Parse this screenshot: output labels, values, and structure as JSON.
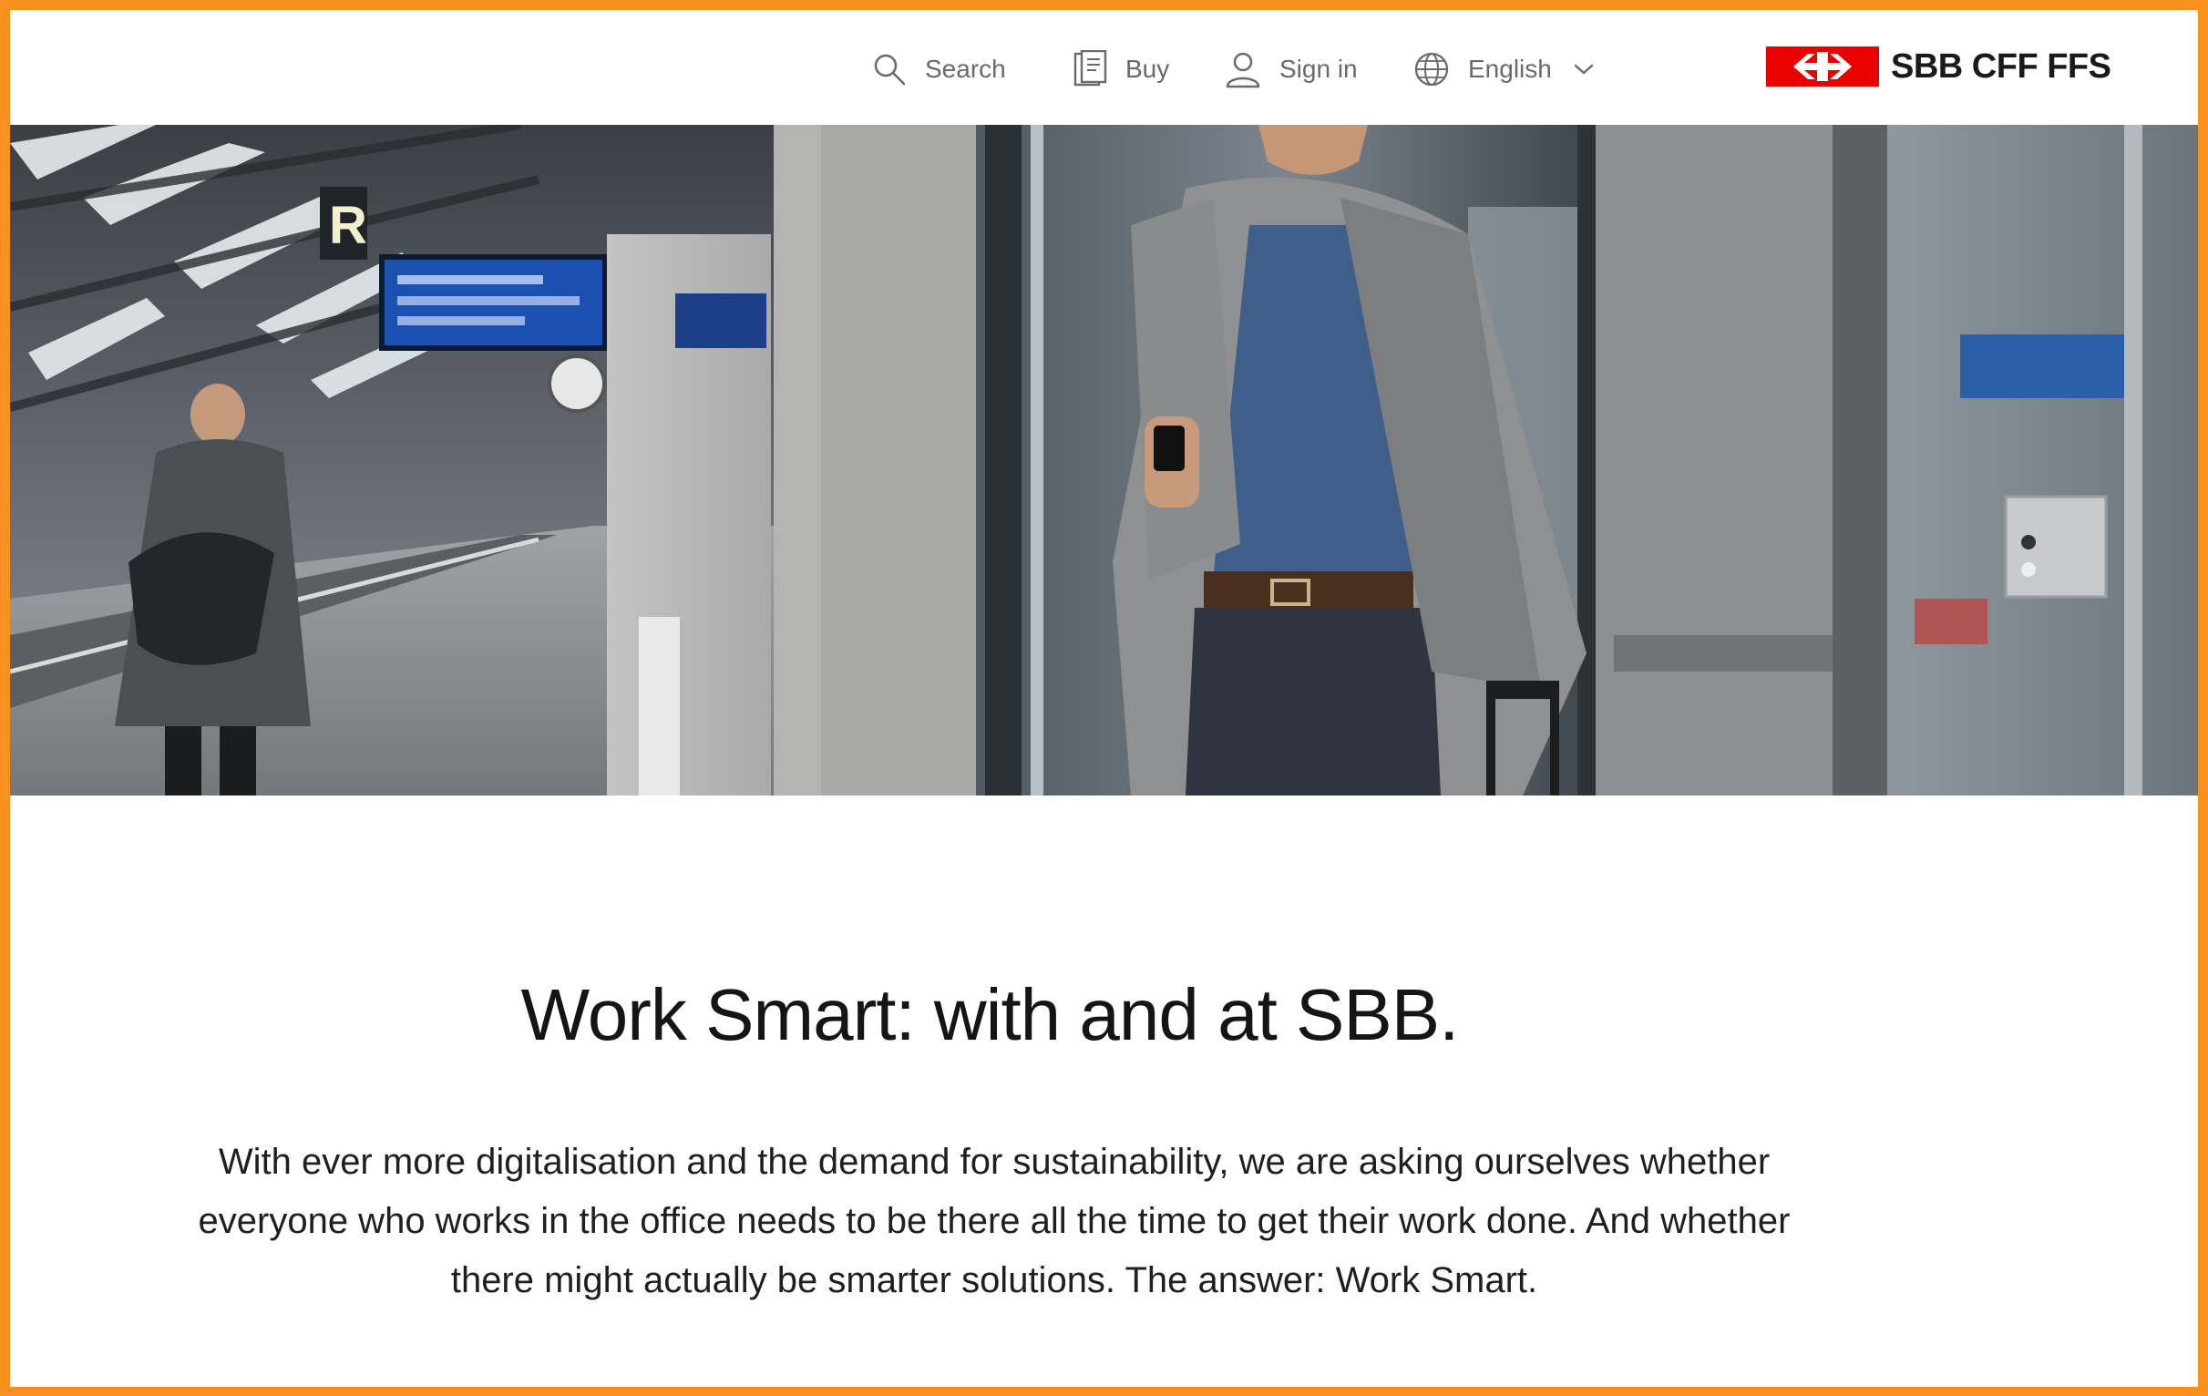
{
  "header": {
    "nav": {
      "search_label": "Search",
      "buy_label": "Buy",
      "signin_label": "Sign in",
      "language_label": "English"
    },
    "logo": {
      "text": "SBB CFF FFS",
      "brand_color": "#eb0000"
    }
  },
  "hero": {
    "image": "train station platform: traveller with backpack walking on platform left; man in grey coat holding phone and suitcase stepping out of glass lift",
    "board_letter": "R"
  },
  "main": {
    "headline": "Work Smart: with and at SBB.",
    "intro": "With ever more digitalisation and the demand for sustainability, we are asking ourselves whether everyone who works in the office needs to be there all the time to get their work done. And whether there might actually be smarter solutions. The answer: Work Smart."
  },
  "colors": {
    "frame": "#f7901e",
    "brand_red": "#eb0000",
    "nav_text": "#6a6a6a"
  }
}
